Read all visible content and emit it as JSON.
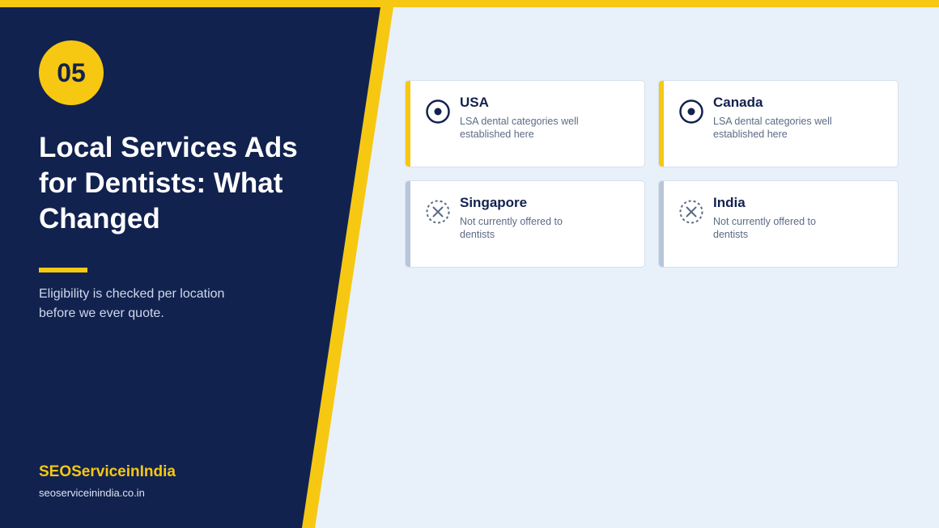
{
  "badge": "05",
  "title": "Local Services Ads for Dentists: What Changed",
  "subtitle": "Eligibility is checked per location before we ever quote.",
  "brand": {
    "name": "SEOServiceinIndia",
    "url": "seoserviceinindia.co.in"
  },
  "colors": {
    "navy": "#12224f",
    "yellow": "#f6c812",
    "background": "#e8f0fa",
    "muted_bar": "#b8c6d8"
  },
  "locations": [
    {
      "name": "USA",
      "status": "LSA dental categories well established here",
      "available": true,
      "icon": "target-dot-icon"
    },
    {
      "name": "Canada",
      "status": "LSA dental categories well established here",
      "available": true,
      "icon": "target-dot-icon"
    },
    {
      "name": "Singapore",
      "status": "Not currently offered to dentists",
      "available": false,
      "icon": "dashed-x-circle-icon"
    },
    {
      "name": "India",
      "status": "Not currently offered to dentists",
      "available": false,
      "icon": "dashed-x-circle-icon"
    }
  ]
}
